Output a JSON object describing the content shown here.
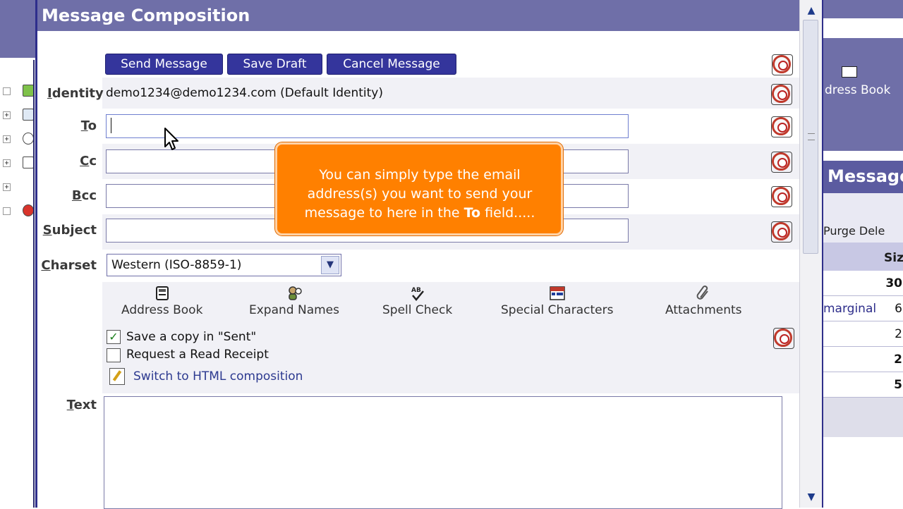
{
  "window": {
    "title": "Message Composition"
  },
  "toolbar": {
    "send_label": "Send Message",
    "save_label": "Save Draft",
    "cancel_label": "Cancel Message"
  },
  "fields": {
    "identity_label_prefix": "I",
    "identity_label_rest": "dentity",
    "identity_value": "demo1234@demo1234.com (Default Identity)",
    "to_label_prefix": "T",
    "to_label_rest": "o",
    "to_value": "",
    "cc_label_prefix": "C",
    "cc_label_rest": "c",
    "cc_value": "",
    "bcc_label_prefix": "B",
    "bcc_label_rest": "cc",
    "bcc_value": "",
    "subject_label_prefix": "S",
    "subject_label_rest": "ubject",
    "subject_value": "",
    "charset_label_prefix": "C",
    "charset_label_rest": "harset",
    "charset_value": "Western (ISO-8859-1)",
    "text_label_prefix": "T",
    "text_label_rest": "ext"
  },
  "tools": {
    "address_book": "Address Book",
    "expand_names": "Expand Names",
    "spell_check": "Spell Check",
    "special_characters": "Special Characters",
    "attachments": "Attachments"
  },
  "options": {
    "save_copy_label": "Save a copy in \"Sent\"",
    "save_copy_checked": true,
    "read_receipt_label": "Request a Read Receipt",
    "read_receipt_checked": false,
    "switch_html_label": "Switch to HTML composition"
  },
  "tooltip": {
    "line1": "You can simply type the email",
    "line2": "address(s) you want to send your",
    "line3_prefix": "message to here in the ",
    "line3_bold": "To",
    "line3_suffix": " field....."
  },
  "background_right": {
    "address_book_label": "dress Book",
    "messages_title": "Message",
    "purge_label": "Purge Dele",
    "size_header": "Siz",
    "rows": [
      {
        "c1": "",
        "c2": "30",
        "bold": true
      },
      {
        "c1": "marginal",
        "c2": "6",
        "bold": false
      },
      {
        "c1": "",
        "c2": "2",
        "bold": false
      },
      {
        "c1": "",
        "c2": "2",
        "bold": true
      },
      {
        "c1": "",
        "c2": "5",
        "bold": true
      }
    ]
  },
  "colors": {
    "title_bar": "#6f6fa8",
    "button_bg": "#34359c",
    "tooltip_bg": "#ff8000",
    "link": "#2d3a90"
  }
}
